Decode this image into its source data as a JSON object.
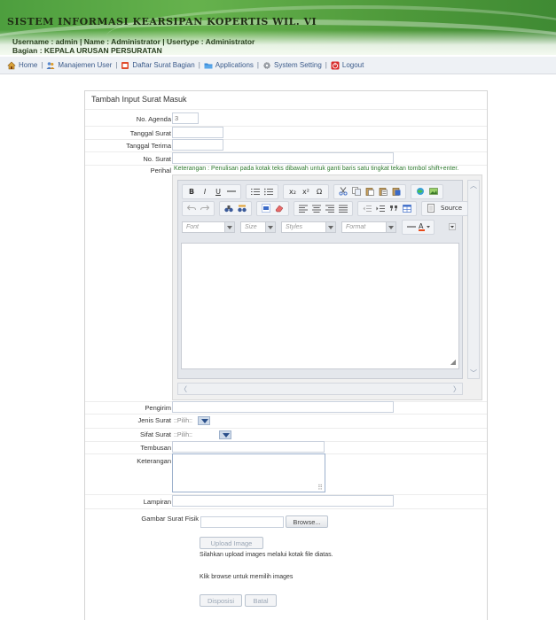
{
  "header": {
    "app_title": "SISTEM INFORMASI KEARSIPAN KOPERTIS WIL. VI",
    "user_line": "Username : admin | Name : Administrator | Usertype : Administrator",
    "bagian_line": "Bagian : KEPALA URUSAN PERSURATAN"
  },
  "nav": {
    "items": [
      {
        "label": "Home",
        "icon": "home-icon"
      },
      {
        "label": "Manajemen User",
        "icon": "users-icon"
      },
      {
        "label": "Daftar Surat Bagian",
        "icon": "mail-icon"
      },
      {
        "label": "Applications",
        "icon": "folder-icon"
      },
      {
        "label": "System Setting",
        "icon": "gear-icon"
      },
      {
        "label": "Logout",
        "icon": "logout-icon"
      }
    ],
    "separator": "|"
  },
  "form": {
    "title": "Tambah Input Surat Masuk",
    "no_agenda": {
      "label": "No. Agenda",
      "value": "3"
    },
    "tanggal_surat": {
      "label": "Tanggal Surat",
      "value": ""
    },
    "tanggal_terima": {
      "label": "Tanggal Terima",
      "value": ""
    },
    "no_surat": {
      "label": "No. Surat",
      "value": ""
    },
    "perihal": {
      "label": "Perihal",
      "hint": "Keterangan : Penulisan pada kotak teks dibawah untuk ganti baris satu tingkat tekan tombol shift+enter."
    },
    "pengirim": {
      "label": "Pengirim",
      "value": ""
    },
    "jenis_surat": {
      "label": "Jenis Surat",
      "selected": "::Pilih::"
    },
    "sifat_surat": {
      "label": "Sifat Surat",
      "selected": "::Pilih::"
    },
    "tembusan": {
      "label": "Tembusan",
      "value": ""
    },
    "keterangan": {
      "label": "Keterangan",
      "value": ""
    },
    "lampiran": {
      "label": "Lampiran",
      "value": ""
    },
    "gambar": {
      "label": "Gambar Surat Fisik",
      "browse_label": "Browse...",
      "upload_label": "Upload Image",
      "info1": "Silahkan upload images melalui kotak file diatas.",
      "info2": "Klik browse untuk memilih images"
    },
    "disposisi_label": "Disposisi",
    "batal_label": "Batal"
  },
  "editor": {
    "font_combo": "Font",
    "size_combo": "Size",
    "styles_combo": "Styles",
    "format_combo": "Format",
    "source_label": "Source",
    "row1": {
      "bold": "B",
      "italic": "I",
      "underline": "U",
      "strike": "S",
      "subscript": "x₂",
      "superscript": "x²",
      "omega": "Ω"
    }
  },
  "theme": {
    "banner_green": "#4d9e3e",
    "nav_text": "#3a5a8a",
    "hint_green": "#2f7a2f"
  }
}
